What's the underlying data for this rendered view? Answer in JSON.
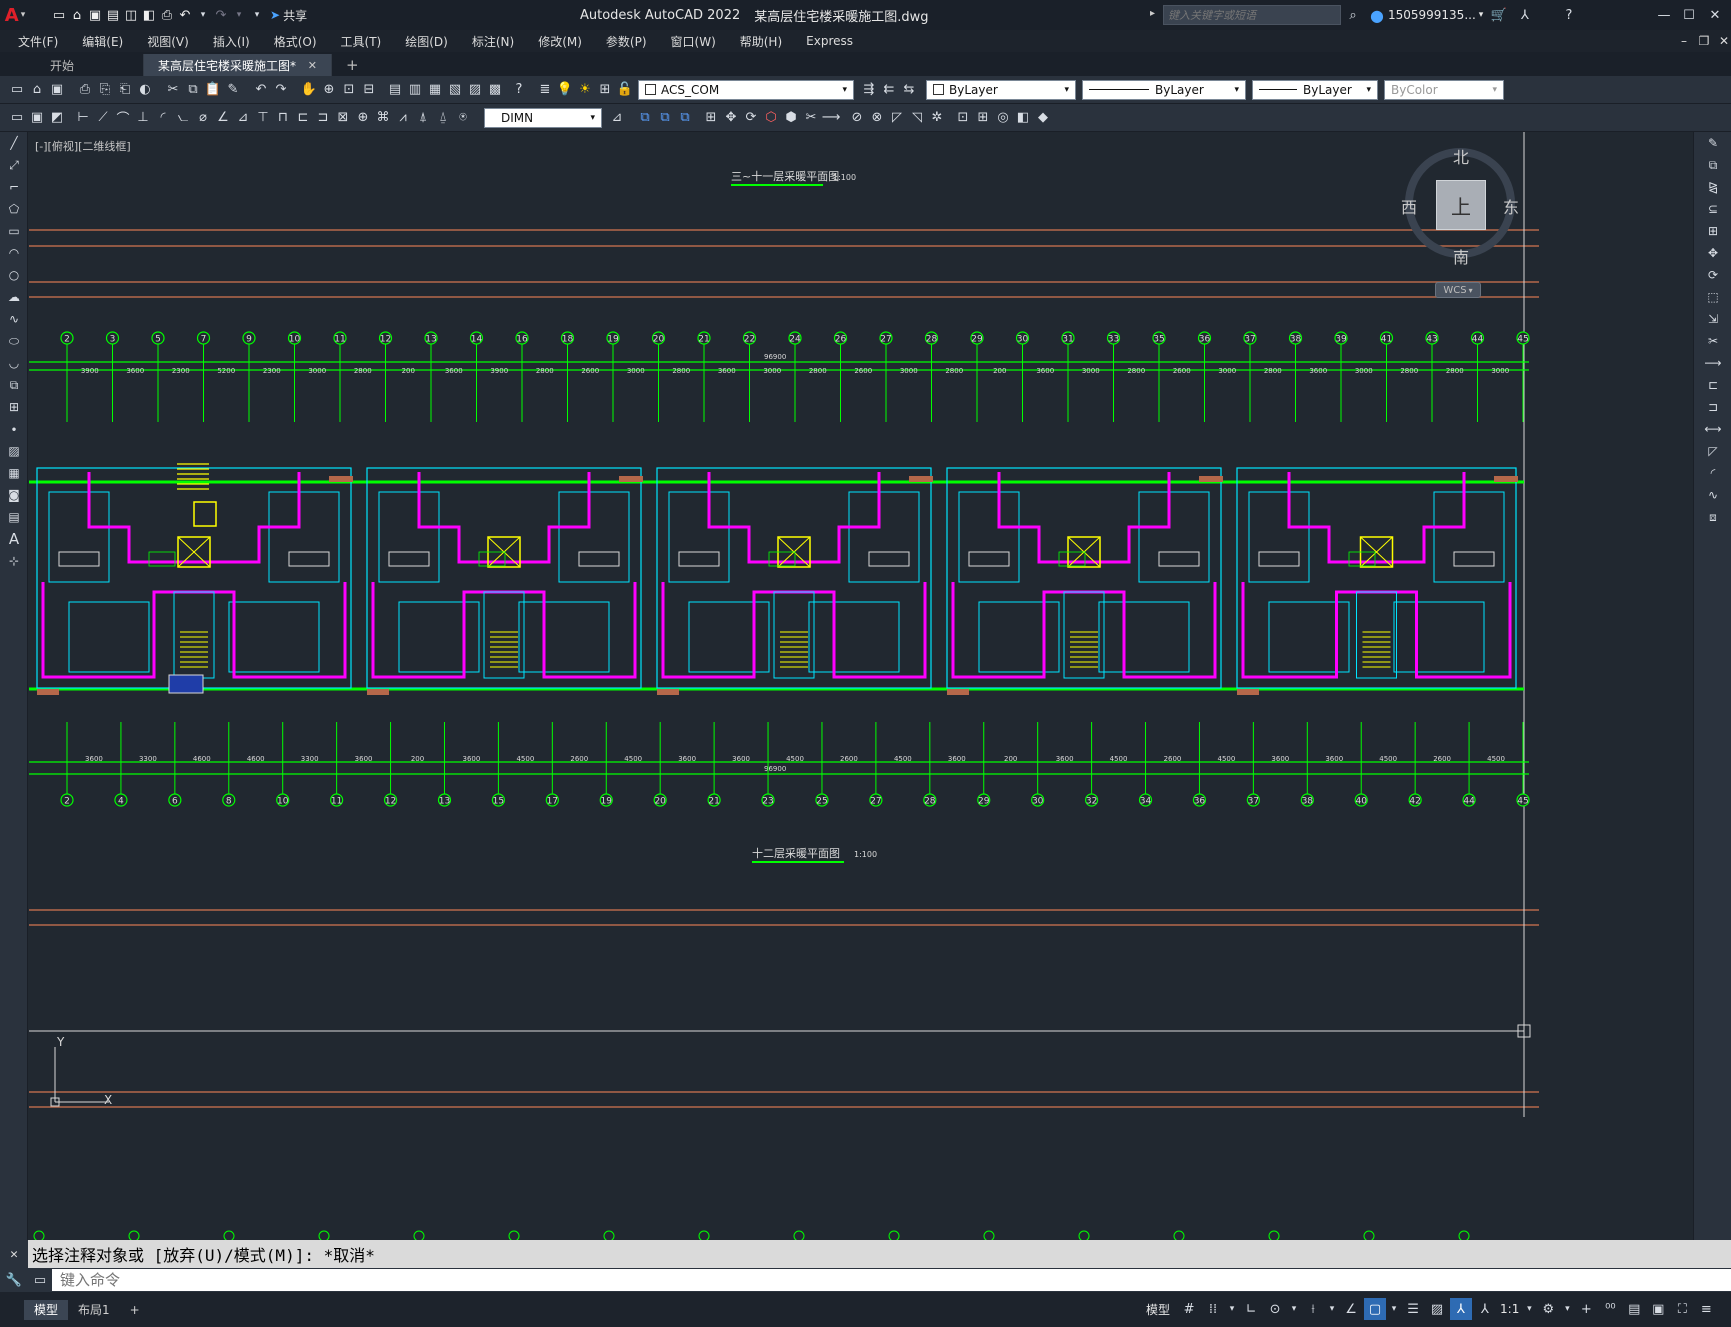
{
  "title": {
    "app": "Autodesk AutoCAD 2022",
    "file": "某高层住宅楼采暖施工图.dwg"
  },
  "quick_access": {
    "share_label": "共享"
  },
  "search": {
    "placeholder": "键入关键字或短语"
  },
  "user": {
    "name": "1505999135..."
  },
  "menu": [
    "文件(F)",
    "编辑(E)",
    "视图(V)",
    "插入(I)",
    "格式(O)",
    "工具(T)",
    "绘图(D)",
    "标注(N)",
    "修改(M)",
    "参数(P)",
    "窗口(W)",
    "帮助(H)",
    "Express"
  ],
  "tabs": [
    {
      "label": "开始"
    },
    {
      "label": "某高层住宅楼采暖施工图*"
    }
  ],
  "toolbar": {
    "layer": "ACS_COM",
    "color": "ByLayer",
    "linetype": "ByLayer",
    "lineweight": "ByLayer",
    "plotstyle": "ByColor",
    "dimstyle": "DIMN"
  },
  "viewport": {
    "label": "[-][俯视][二维线框]"
  },
  "viewcube": {
    "north": "北",
    "south": "南",
    "east": "东",
    "west": "西",
    "top": "上",
    "wcs": "WCS"
  },
  "drawing": {
    "title_upper": "三~十一层采暖平面图",
    "title_lower": "十二层采暖平面图",
    "scale": "1:100",
    "total_dim_top": "96900",
    "total_dim_bottom": "96900",
    "top_axes": [
      "2",
      "3",
      "5",
      "7",
      "9",
      "10",
      "11",
      "12",
      "13",
      "14",
      "16",
      "18",
      "19",
      "20",
      "21",
      "22",
      "24",
      "26",
      "27",
      "28",
      "29",
      "30",
      "31",
      "33",
      "35",
      "36",
      "37",
      "38",
      "39",
      "41",
      "43",
      "44",
      "45"
    ],
    "top_dims": [
      "3900",
      "3600",
      "2300",
      "5200",
      "2300",
      "3000",
      "2800",
      "200",
      "3600",
      "3900",
      "2800",
      "2600",
      "3000",
      "2800",
      "3600",
      "3000",
      "2800",
      "2600",
      "3000",
      "2800",
      "200",
      "3600",
      "3000",
      "2800",
      "2600",
      "3000",
      "2800",
      "3600",
      "3000",
      "2800",
      "2800",
      "3000",
      "3600"
    ],
    "bottom_axes": [
      "2",
      "4",
      "6",
      "8",
      "10",
      "11",
      "12",
      "13",
      "15",
      "17",
      "19",
      "20",
      "21",
      "23",
      "25",
      "27",
      "28",
      "29",
      "30",
      "32",
      "34",
      "36",
      "37",
      "38",
      "40",
      "42",
      "44",
      "45"
    ],
    "bottom_dims": [
      "3600",
      "3300",
      "4600",
      "4600",
      "3300",
      "3600",
      "200",
      "3600",
      "4500",
      "2600",
      "4500",
      "3600",
      "3600",
      "4500",
      "2600",
      "4500",
      "3600",
      "200",
      "3600",
      "4500",
      "2600",
      "4500",
      "3600",
      "3600",
      "4500",
      "2600",
      "4500",
      "3600"
    ]
  },
  "command": {
    "history": "选择注释对象或 [放弃(U)/模式(M)]: *取消*",
    "placeholder": "键入命令"
  },
  "status": {
    "layout_tabs": [
      "模型",
      "布局1"
    ],
    "model_label": "模型",
    "scale": "1:1"
  }
}
